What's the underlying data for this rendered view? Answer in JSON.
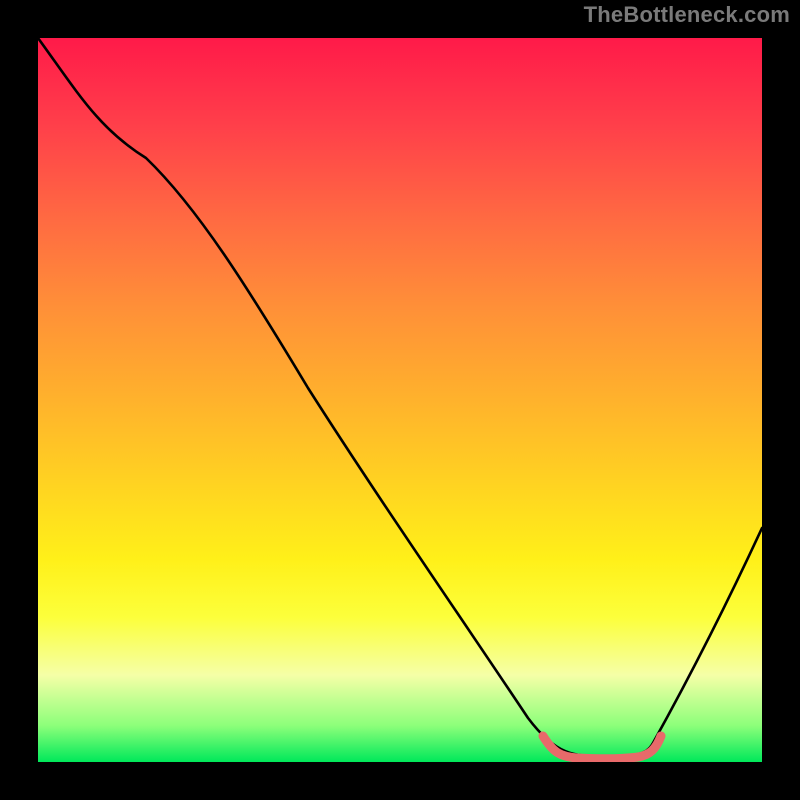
{
  "watermark": "TheBottleneck.com",
  "colors": {
    "frame": "#000000",
    "curve": "#000000",
    "highlight": "#e86a6a",
    "gradient_top": "#ff1a49",
    "gradient_bottom": "#00e85a"
  },
  "chart_data": {
    "type": "line",
    "title": "",
    "xlabel": "",
    "ylabel": "",
    "xlim": [
      0,
      100
    ],
    "ylim": [
      0,
      100
    ],
    "grid": false,
    "legend": false,
    "series": [
      {
        "name": "main_curve",
        "x": [
          0,
          10,
          15,
          20,
          26,
          34,
          43,
          52,
          60,
          67,
          71,
          76,
          80,
          84,
          88,
          92,
          96,
          100
        ],
        "y": [
          100,
          89,
          84,
          78,
          70,
          59,
          46,
          33,
          22,
          11,
          5,
          1,
          0.5,
          0.5,
          4,
          12,
          22,
          33
        ]
      },
      {
        "name": "bottom_highlight",
        "x": [
          71,
          73,
          76,
          80,
          84,
          85,
          86
        ],
        "y": [
          5,
          2.2,
          1.0,
          0.6,
          0.8,
          2.2,
          5
        ]
      }
    ],
    "annotations": []
  }
}
